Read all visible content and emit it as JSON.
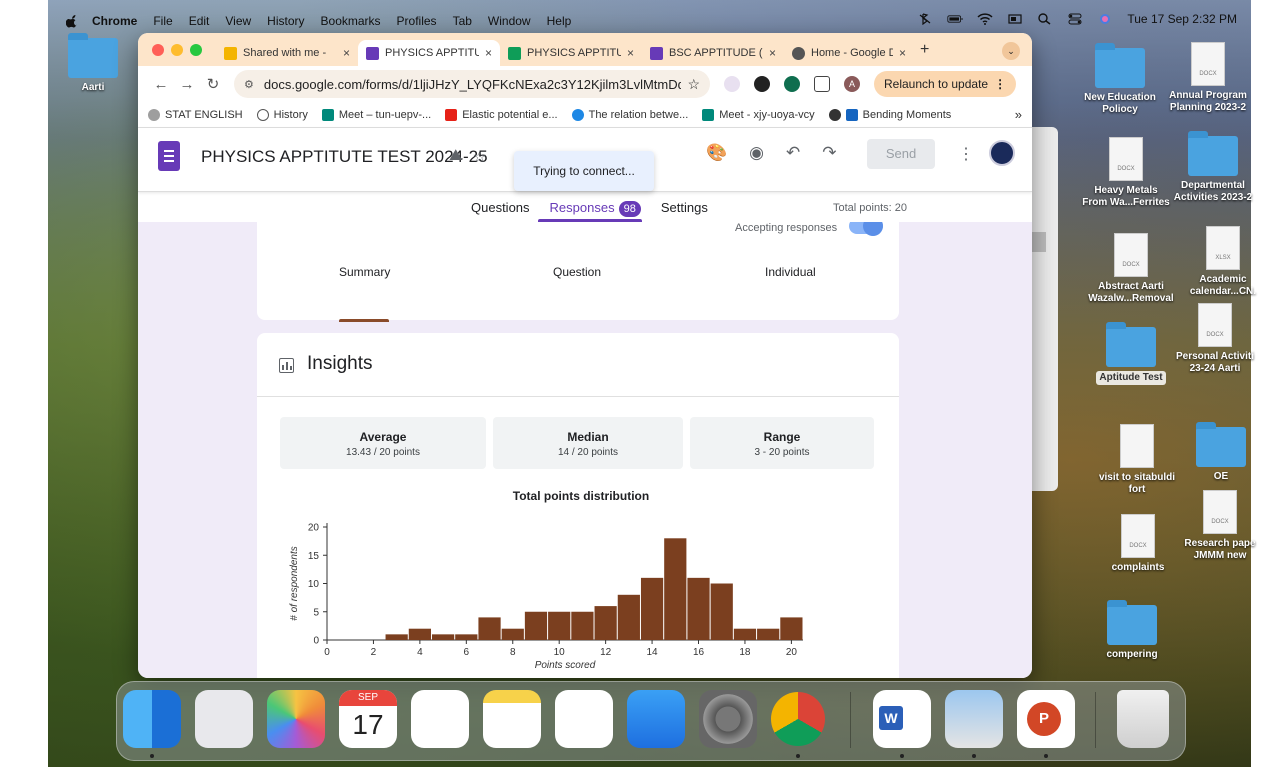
{
  "menubar": {
    "app": "Chrome",
    "items": [
      "File",
      "Edit",
      "View",
      "History",
      "Bookmarks",
      "Profiles",
      "Tab",
      "Window",
      "Help"
    ],
    "clock": "Tue 17 Sep  2:32 PM"
  },
  "tabs": [
    {
      "label": "Shared with me -",
      "icon_color": "#f4b400",
      "close": "×"
    },
    {
      "label": "PHYSICS APPTITU",
      "icon_color": "#673ab7",
      "close": "×"
    },
    {
      "label": "PHYSICS APPTITU",
      "icon_color": "#0f9d58",
      "close": "×"
    },
    {
      "label": "BSC APPTITUDE (",
      "icon_color": "#673ab7",
      "close": "×"
    },
    {
      "label": "Home - Google D",
      "icon_color": "#555555",
      "close": "×"
    }
  ],
  "newtab": "+",
  "toolbar": {
    "url": "docs.google.com/forms/d/1ljiJHzY_LYQFKcNExa2c3Y12Kjilm3LvlMtmDd_...",
    "profile_initial": "A",
    "relaunch": "Relaunch to update"
  },
  "bookmarks": [
    "STAT ENGLISH",
    "History",
    "Meet – tun-uepv-...",
    "Elastic potential e...",
    "The relation betwe...",
    "Meet - xjy-uoya-vcy",
    "Bending Moments"
  ],
  "bookmarks_more": "»",
  "form": {
    "title": "PHYSICS APPTITUTE TEST  2024-25",
    "send": "Send",
    "trying": "Trying to connect...",
    "nav": {
      "questions": "Questions",
      "responses": "Responses",
      "response_count": "98",
      "settings": "Settings"
    },
    "total_points": "Total points: 20",
    "accepting": "Accepting responses",
    "subtabs": [
      "Summary",
      "Question",
      "Individual"
    ],
    "insights_title": "Insights",
    "stats": [
      {
        "label": "Average",
        "value": "13.43 / 20 points"
      },
      {
        "label": "Median",
        "value": "14 / 20 points"
      },
      {
        "label": "Range",
        "value": "3 - 20 points"
      }
    ],
    "help": "?"
  },
  "chart_data": {
    "type": "bar",
    "title": "Total points distribution",
    "xlabel": "Points scored",
    "ylabel": "# of respondents",
    "x": [
      3,
      4,
      5,
      6,
      7,
      8,
      9,
      10,
      11,
      12,
      13,
      14,
      15,
      16,
      17,
      18,
      19,
      20
    ],
    "values": [
      1,
      2,
      1,
      1,
      4,
      2,
      5,
      5,
      5,
      6,
      8,
      11,
      18,
      11,
      10,
      2,
      2,
      4
    ],
    "xticks": [
      0,
      2,
      4,
      6,
      8,
      10,
      12,
      14,
      16,
      18,
      20
    ],
    "yticks": [
      0,
      5,
      10,
      15,
      20
    ],
    "xlim": [
      0,
      20.5
    ],
    "ylim": [
      0,
      20
    ],
    "bar_color": "#7b3f1f",
    "grid": false
  },
  "desktop_icons": [
    {
      "label": "Aarti",
      "type": "folder"
    },
    {
      "label": "New Education Poliocy",
      "type": "folder"
    },
    {
      "label": "Annual Program Planning 2023-2",
      "type": "doc",
      "ext": "DOCX"
    },
    {
      "label": "Heavy Metals From Wa...Ferrites",
      "type": "doc",
      "ext": "DOCX"
    },
    {
      "label": "Departmental Activities 2023-2",
      "type": "folder"
    },
    {
      "label": "Abstract Aarti Wazalw...Removal",
      "type": "doc",
      "ext": "DOCX"
    },
    {
      "label": "Academic calendar...CN.",
      "type": "doc",
      "ext": "XLSX"
    },
    {
      "label": "Aptitude Test",
      "type": "folder"
    },
    {
      "label": "Personal Activiti 23-24 Aarti",
      "type": "doc",
      "ext": "DOCX"
    },
    {
      "label": "visit to sitabuldi fort",
      "type": "doc",
      "ext": ""
    },
    {
      "label": "OE",
      "type": "folder"
    },
    {
      "label": "complaints",
      "type": "doc",
      "ext": "DOCX"
    },
    {
      "label": "Research pape JMMM new",
      "type": "doc",
      "ext": "DOCX"
    },
    {
      "label": "compering",
      "type": "folder"
    }
  ],
  "dock": {
    "calendar_month": "SEP",
    "calendar_day": "17",
    "apps": [
      "finder-icon",
      "launchpad-icon",
      "photos-icon",
      "calendar-icon",
      "reminders-icon",
      "notes-icon",
      "freeform-icon",
      "app-store-icon",
      "system-settings-icon",
      "chrome-icon",
      "word-icon",
      "preview-icon",
      "powerpoint-icon",
      "trash-icon"
    ]
  }
}
